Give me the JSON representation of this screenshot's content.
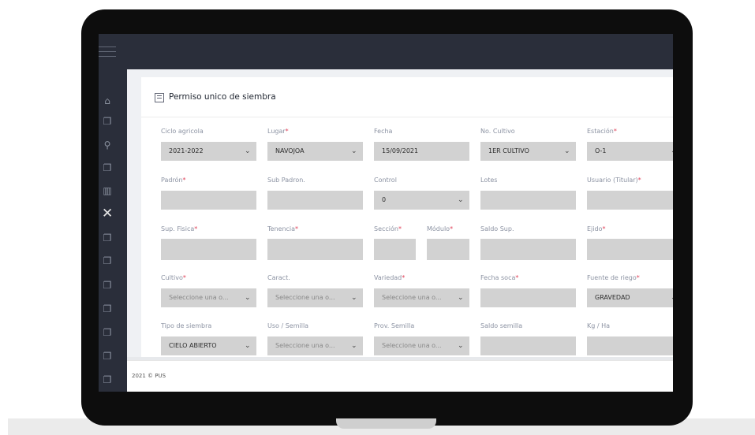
{
  "page": {
    "title": "Permiso unico de siembra",
    "footer": "2021 © PUS"
  },
  "sidebar": {
    "items": [
      {
        "icon": "home-icon"
      },
      {
        "icon": "document-icon"
      },
      {
        "icon": "user-icon"
      },
      {
        "icon": "document-icon"
      },
      {
        "icon": "grid-icon"
      },
      {
        "icon": "close-icon"
      },
      {
        "icon": "document-icon"
      },
      {
        "icon": "document-icon"
      },
      {
        "icon": "document-icon"
      },
      {
        "icon": "document-icon"
      },
      {
        "icon": "document-icon"
      },
      {
        "icon": "document-icon"
      },
      {
        "icon": "document-icon"
      }
    ]
  },
  "form": {
    "ciclo": {
      "label": "Ciclo agricola",
      "value": "2021-2022"
    },
    "lugar": {
      "label": "Lugar",
      "value": "NAVOJOA"
    },
    "fecha": {
      "label": "Fecha",
      "value": "15/09/2021"
    },
    "no_cultivo": {
      "label": "No. Cultivo",
      "value": "1ER CULTIVO"
    },
    "estacion": {
      "label": "Estación",
      "value": "O-1"
    },
    "padron": {
      "label": "Padrón",
      "value": ""
    },
    "sub_padron": {
      "label": "Sub Padron.",
      "value": ""
    },
    "control": {
      "label": "Control",
      "value": "0"
    },
    "lotes": {
      "label": "Lotes",
      "value": ""
    },
    "usuario": {
      "label": "Usuario (Titular)",
      "value": ""
    },
    "sup_fisica": {
      "label": "Sup. Fisica",
      "value": ""
    },
    "tenencia": {
      "label": "Tenencia",
      "value": ""
    },
    "seccion": {
      "label": "Sección",
      "value": ""
    },
    "modulo": {
      "label": "Módulo",
      "value": ""
    },
    "saldo_sup": {
      "label": "Saldo Sup.",
      "value": ""
    },
    "ejido": {
      "label": "Ejido",
      "value": ""
    },
    "cultivo": {
      "label": "Cultivo",
      "value": "Seleccione una o..."
    },
    "caract": {
      "label": "Caract.",
      "value": "Seleccione una o..."
    },
    "variedad": {
      "label": "Variedad",
      "value": "Seleccione una o..."
    },
    "fecha_soca": {
      "label": "Fecha soca",
      "value": ""
    },
    "fuente_riego": {
      "label": "Fuente de riego",
      "value": "GRAVEDAD"
    },
    "tipo_siembra": {
      "label": "Tipo de siembra",
      "value": "CIELO ABIERTO"
    },
    "uso_semilla": {
      "label": "Uso / Semilla",
      "value": "Seleccione una o..."
    },
    "prov_semilla": {
      "label": "Prov. Semilla",
      "value": "Seleccione una o..."
    },
    "saldo_semilla": {
      "label": "Saldo semilla",
      "value": ""
    },
    "kg_ha": {
      "label": "Kg / Ha",
      "value": ""
    },
    "required_mark": "*",
    "chevron": "⌄"
  }
}
